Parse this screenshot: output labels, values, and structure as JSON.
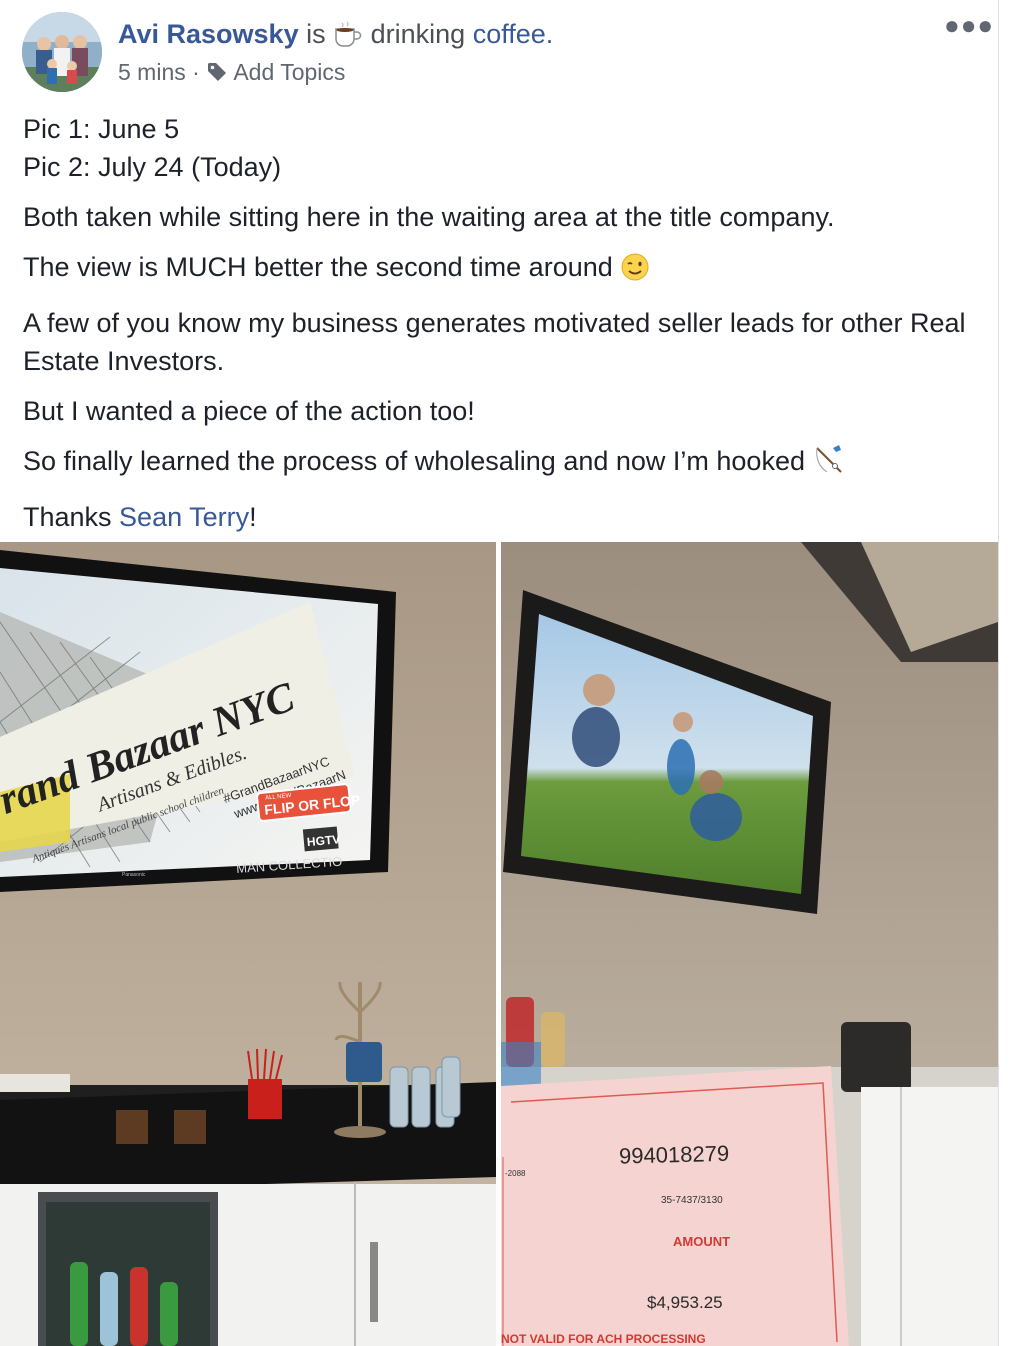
{
  "post": {
    "author": "Avi Rasowsky",
    "is_text": "is",
    "activity": "drinking",
    "activity_object": "coffee.",
    "activity_icon": "coffee-cup-icon",
    "time": "5 mins",
    "separator": "·",
    "add_topics": "Add Topics",
    "more_icon": "more-options-icon",
    "lines": {
      "l1": "Pic 1: June 5",
      "l2": "Pic 2: July 24 (Today)",
      "l3": "Both taken while sitting here in the waiting area at the title company.",
      "l4": "The view is MUCH better the second time around",
      "l5": "A few of you know my business generates motivated seller leads for other Real Estate Investors.",
      "l6": "But I wanted a piece of the action too!",
      "l7": "So finally learned the process of wholesaling and now I’m hooked",
      "l8_pre": "Thanks ",
      "l8_mention": "Sean Terry",
      "l8_post": "!"
    },
    "emojis": [
      "winking-face-icon",
      "fishing-pole-icon"
    ]
  },
  "photo1": {
    "tv_banner_title": "rand Bazaar NYC",
    "tv_banner_sub": "Artisans & Edibles.",
    "tv_banner_small": "Antiques   Artisans   local public school children",
    "tv_hashtag": "#GrandBazaarNYC",
    "tv_url": "www.GrandBazaarN",
    "tv_show_logo_top": "ALL NEW",
    "tv_show_logo": "FLIP OR FLOP",
    "tv_network": "HGTV",
    "tv_brand": "Panasonic",
    "tv_bottom": "MAN COLLECTIO"
  },
  "photo2": {
    "check_number": "994018279",
    "routing": "35-7437/3130",
    "amount_label": "AMOUNT",
    "amount": "$4,953.25",
    "side_num": "-2088",
    "not_valid": "NOT VALID FOR ACH PROCESSING"
  }
}
